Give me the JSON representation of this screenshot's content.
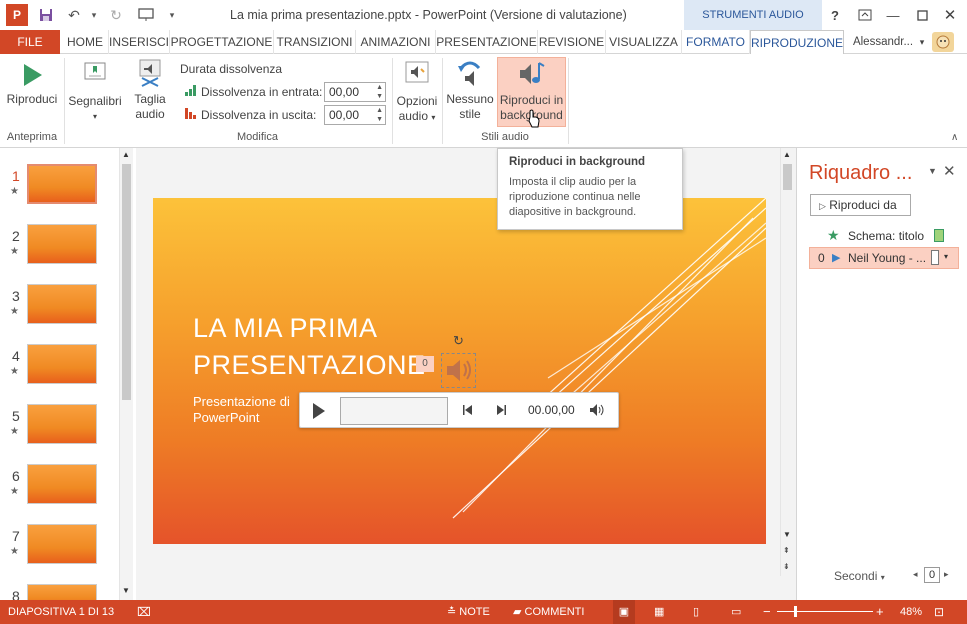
{
  "titlebar": {
    "title": "La mia prima presentazione.pptx - PowerPoint (Versione di valutazione)",
    "context_header": "STRUMENTI AUDIO",
    "help": "?"
  },
  "tabs": {
    "file": "FILE",
    "home": "HOME",
    "inserisci": "INSERISCI",
    "progettazione": "PROGETTAZIONE",
    "transizioni": "TRANSIZIONI",
    "animazioni": "ANIMAZIONI",
    "presentazione": "PRESENTAZIONE",
    "revisione": "REVISIONE",
    "visualizza": "VISUALIZZA",
    "formato": "FORMATO",
    "riproduzione": "RIPRODUZIONE",
    "user": "Alessandr..."
  },
  "ribbon": {
    "riproduci": "Riproduci",
    "anteprima_group": "Anteprima",
    "segnalibri": "Segnalibri",
    "taglia_1": "Taglia",
    "taglia_2": "audio",
    "durata": "Durata dissolvenza",
    "entrata_label": "Dissolvenza in entrata:",
    "entrata_value": "00,00",
    "uscita_label": "Dissolvenza in uscita:",
    "uscita_value": "00,00",
    "modifica_group": "Modifica",
    "opzioni_1": "Opzioni",
    "opzioni_2": "audio",
    "nessuno_1": "Nessuno",
    "nessuno_2": "stile",
    "background_1": "Riproduci in",
    "background_2": "background",
    "stili_group": "Stili audio"
  },
  "tooltip": {
    "title": "Riproduci in background",
    "body": "Imposta il clip audio per la riproduzione continua nelle diapositive in background."
  },
  "thumbnails": [
    "1",
    "2",
    "3",
    "4",
    "5",
    "6",
    "7",
    "8"
  ],
  "slide": {
    "title": "LA MIA PRIMA PRESENTAZIONE",
    "subtitle": "Presentazione di PowerPoint",
    "audio_badge": "0"
  },
  "player": {
    "time": "00.00,00"
  },
  "anim_pane": {
    "title": "Riquadro ...",
    "play_from": "Riproduci da",
    "item1": "Schema: titolo",
    "item2_num": "0",
    "item2": "Neil Young - ...",
    "seconds": "Secondi",
    "zoom_value": "0"
  },
  "status": {
    "slide_info": "DIAPOSITIVA 1 DI 13",
    "note": "NOTE",
    "comments": "COMMENTI",
    "zoom": "48%"
  },
  "colors": {
    "accent": "#d24726",
    "ribbon_highlight": "#fbd0c2"
  }
}
